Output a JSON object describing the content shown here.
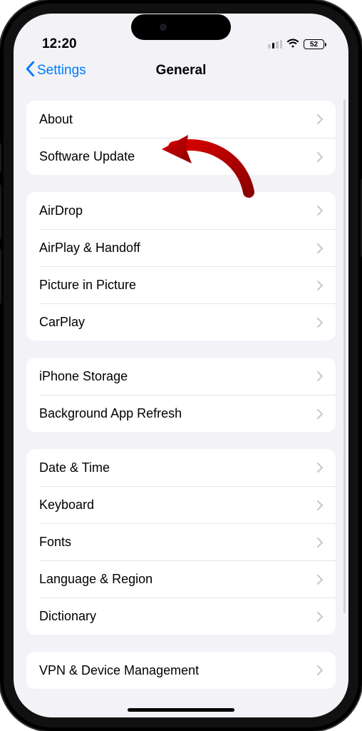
{
  "status": {
    "time": "12:20",
    "battery": "52"
  },
  "nav": {
    "back": "Settings",
    "title": "General"
  },
  "groups": [
    [
      {
        "label": "About"
      },
      {
        "label": "Software Update"
      }
    ],
    [
      {
        "label": "AirDrop"
      },
      {
        "label": "AirPlay & Handoff"
      },
      {
        "label": "Picture in Picture"
      },
      {
        "label": "CarPlay"
      }
    ],
    [
      {
        "label": "iPhone Storage"
      },
      {
        "label": "Background App Refresh"
      }
    ],
    [
      {
        "label": "Date & Time"
      },
      {
        "label": "Keyboard"
      },
      {
        "label": "Fonts"
      },
      {
        "label": "Language & Region"
      },
      {
        "label": "Dictionary"
      }
    ],
    [
      {
        "label": "VPN & Device Management"
      }
    ]
  ]
}
